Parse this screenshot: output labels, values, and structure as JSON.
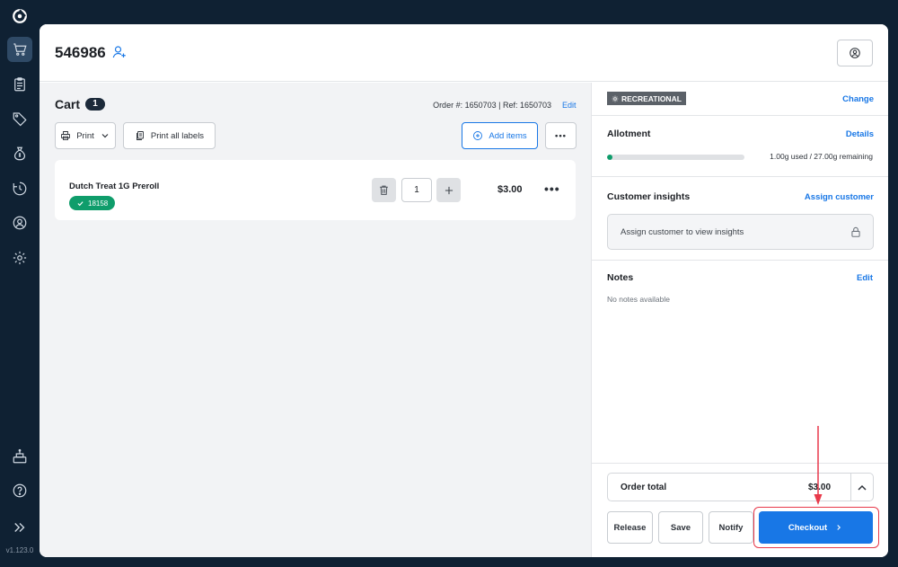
{
  "app": {
    "version": "v1.123.0"
  },
  "sidebar": {
    "items": [
      {
        "icon": "cart-icon",
        "active": true
      },
      {
        "icon": "clipboard-icon"
      },
      {
        "icon": "tag-icon"
      },
      {
        "icon": "money-bag-icon"
      },
      {
        "icon": "history-icon"
      },
      {
        "icon": "customer-icon"
      },
      {
        "icon": "gear-icon"
      }
    ],
    "bottom_items": [
      {
        "icon": "register-icon"
      },
      {
        "icon": "help-icon"
      },
      {
        "icon": "expand-icon"
      }
    ]
  },
  "header": {
    "order_id": "546986"
  },
  "cart": {
    "title": "Cart",
    "count": "1",
    "order_ref": "Order #: 1650703 | Ref: 1650703",
    "edit_label": "Edit",
    "print_label": "Print",
    "print_all_label": "Print all labels",
    "add_items_label": "Add items",
    "more_label": "•••",
    "items": [
      {
        "name": "Dutch Treat 1G Preroll",
        "tag": "18158",
        "quantity": "1",
        "price": "$3.00",
        "more": "•••"
      }
    ]
  },
  "customer_panel": {
    "type_badge": "RECREATIONAL",
    "change_label": "Change",
    "allotment": {
      "title": "Allotment",
      "details_label": "Details",
      "used": 1.0,
      "total": 27.0,
      "summary": "1.00g used / 27.00g remaining"
    },
    "insights": {
      "title": "Customer insights",
      "assign_label": "Assign customer",
      "placeholder": "Assign customer to view insights"
    },
    "notes": {
      "title": "Notes",
      "edit_label": "Edit",
      "empty_text": "No notes available"
    },
    "order_total": {
      "label": "Order total",
      "value": "$3.00"
    },
    "actions": {
      "release": "Release",
      "save": "Save",
      "notify": "Notify",
      "checkout": "Checkout"
    }
  },
  "colors": {
    "accent": "#1877e6",
    "success": "#0f9d6b",
    "sidebar": "#0f2133",
    "highlight": "#e8394a"
  }
}
